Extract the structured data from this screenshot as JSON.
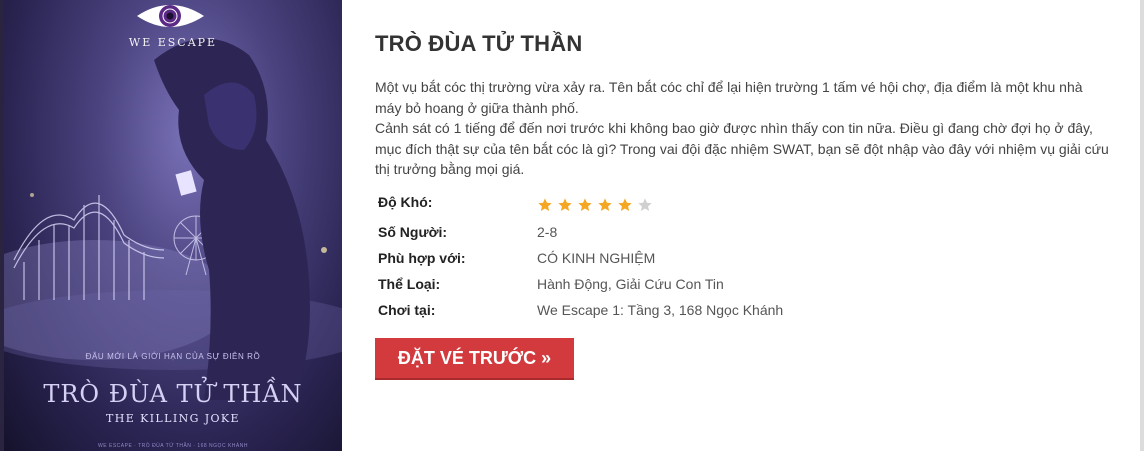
{
  "poster": {
    "logo_text": "WE ESCAPE",
    "tagline": "ĐÂU MỚI LÀ GIỚI HẠN CỦA SỰ ĐIÊN RỒ",
    "title": "TRÒ ĐÙA TỬ THẦN",
    "subtitle": "THE KILLING JOKE",
    "footer": "WE ESCAPE · TRÒ ĐÙA TỬ THẦN · 168 NGỌC KHÁNH"
  },
  "game": {
    "title": "TRÒ ĐÙA TỬ THẦN",
    "description": [
      "Một vụ bắt cóc thị trường vừa xảy ra. Tên bắt cóc chỉ để lại hiện trường 1 tấm vé hội chợ, địa điểm là một khu nhà máy bỏ hoang ở giữa thành phố.",
      "Cảnh sát có 1 tiếng để đến nơi trước khi không bao giờ được nhìn thấy con tin nữa. Điều gì đang chờ đợi họ ở đây, mục đích thật sự của tên bắt cóc là gì? Trong vai đội đặc nhiệm SWAT, bạn sẽ đột nhập vào đây với nhiệm vụ giải cứu thị trưởng bằng mọi giá."
    ]
  },
  "info": {
    "difficulty_label": "Độ Khó:",
    "difficulty_rating": 5,
    "difficulty_max": 6,
    "players_label": "Số Người:",
    "players_value": "2-8",
    "suitable_label": "Phù hợp với:",
    "suitable_value": "CÓ KINH NGHIỆM",
    "genre_label": "Thể Loại:",
    "genre_value": "Hành Động, Giải Cứu Con Tin",
    "location_label": "Chơi tại:",
    "location_value": "We Escape 1: Tầng 3, 168 Ngọc Khánh"
  },
  "actions": {
    "book_label": "ĐẶT VÉ TRƯỚC »"
  },
  "colors": {
    "star_filled": "#f5a623",
    "star_empty": "#d0d0d0",
    "button_bg": "#d23a3e"
  }
}
